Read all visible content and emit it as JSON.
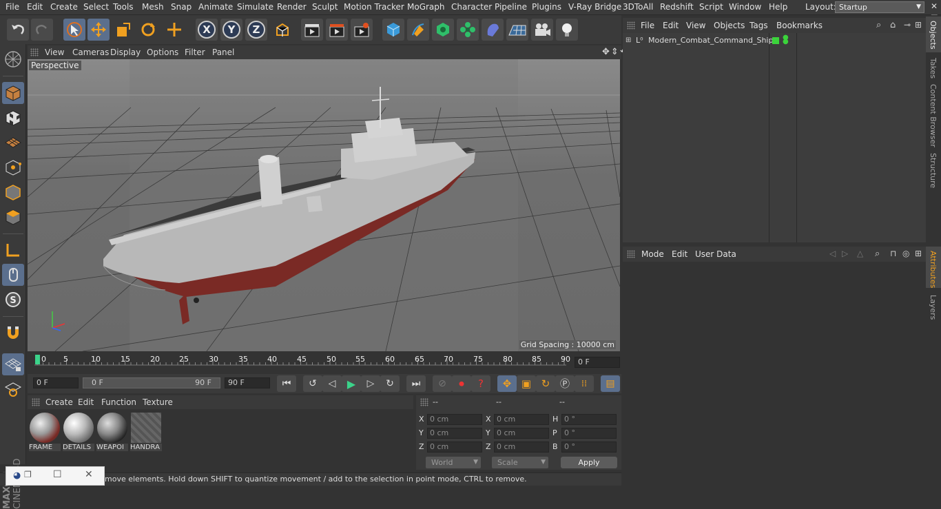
{
  "menubar": {
    "items": [
      "File",
      "Edit",
      "Create",
      "Select",
      "Tools",
      "Mesh",
      "Snap",
      "Animate",
      "Simulate",
      "Render",
      "Sculpt",
      "Motion Tracker",
      "MoGraph",
      "Character",
      "Pipeline",
      "Plugins",
      "V-Ray Bridge",
      "3DToAll",
      "Redshift",
      "Script",
      "Window",
      "Help"
    ],
    "layout_label": "Layout:",
    "layout_value": "Startup"
  },
  "toolbar": {
    "axis_x": "X",
    "axis_y": "Y",
    "axis_z": "Z"
  },
  "viewport": {
    "menu": [
      "View",
      "Cameras",
      "Display",
      "Options",
      "Filter",
      "Panel"
    ],
    "label": "Perspective",
    "grid_spacing": "Grid Spacing : 10000 cm"
  },
  "timeline": {
    "ticks": [
      "0",
      "5",
      "10",
      "15",
      "20",
      "25",
      "30",
      "35",
      "40",
      "45",
      "50",
      "55",
      "60",
      "65",
      "70",
      "75",
      "80",
      "85",
      "90"
    ],
    "current_frame": "0 F"
  },
  "playback": {
    "start_field": "0 F",
    "range_start": "0 F",
    "range_end": "90 F",
    "end_field": "90 F"
  },
  "materials": {
    "menu": [
      "Create",
      "Edit",
      "Function",
      "Texture"
    ],
    "items": [
      {
        "name": "FRAME"
      },
      {
        "name": "DETAILS"
      },
      {
        "name": "WEAPOI"
      },
      {
        "name": "HANDRA"
      }
    ]
  },
  "coords": {
    "headers": [
      "--",
      "--",
      "--"
    ],
    "rows": [
      {
        "l1": "X",
        "v1": "0 cm",
        "l2": "X",
        "v2": "0 cm",
        "l3": "H",
        "v3": "0 °"
      },
      {
        "l1": "Y",
        "v1": "0 cm",
        "l2": "Y",
        "v2": "0 cm",
        "l3": "P",
        "v3": "0 °"
      },
      {
        "l1": "Z",
        "v1": "0 cm",
        "l2": "Z",
        "v2": "0 cm",
        "l3": "B",
        "v3": "0 °"
      }
    ],
    "mode": "World",
    "type": "Scale",
    "apply": "Apply"
  },
  "status": {
    "text": "move elements. Hold down SHIFT to quantize movement / add to the selection in point mode, CTRL to remove."
  },
  "objects": {
    "menu": [
      "File",
      "Edit",
      "View",
      "Objects",
      "Tags",
      "Bookmarks"
    ],
    "items": [
      {
        "name": "Modern_Combat_Command_Ship"
      }
    ]
  },
  "attributes": {
    "menu": [
      "Mode",
      "Edit",
      "User Data"
    ]
  },
  "sidetabs": [
    "Objects",
    "Takes",
    "Content Browser",
    "Structure",
    "Attributes",
    "Layers"
  ],
  "branding": {
    "maxon": "MAXON",
    "cinema": "CINEMA 4D"
  },
  "colors": {
    "accent": "#5b6f8d",
    "hull_red": "#8a2a25",
    "deck": "#3c3c3c"
  }
}
